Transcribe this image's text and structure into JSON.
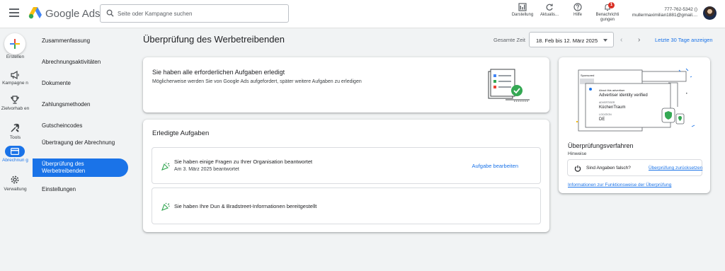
{
  "header": {
    "brand": "Google Ads",
    "search_placeholder": "Seite oder Kampagne suchen",
    "tools": {
      "appearance": "Darstellung",
      "refresh": "Aktualis...",
      "help": "Hilfe",
      "notifications": "Benachrichti gungen",
      "notification_count": "1"
    },
    "account_id": "777-762-5342 ()",
    "account_email": "mullermaximilian1881@gmail...."
  },
  "rail": {
    "create": "Erstellen",
    "campaigns": "Kampagne n",
    "goals": "Zielvorhab en",
    "tools": "Tools",
    "billing": "Abrechnun g",
    "admin": "Verwaltung"
  },
  "subnav": {
    "items": [
      "Zusammenfassung",
      "Abrechnungsaktivitäten",
      "Dokumente",
      "Zahlungsmethoden",
      "Gutscheincodes",
      "Übertragung der Abrechnung",
      "Überprüfung des Werbetreibenden",
      "Einstellungen"
    ]
  },
  "page": {
    "title": "Überprüfung des Werbetreibenden",
    "range_label": "Gesamte Zeit",
    "range_value": "18. Feb bis 12. März 2025",
    "last30": "Letzte 30 Tage anzeigen"
  },
  "summary": {
    "title": "Sie haben alle erforderlichen Aufgaben erledigt",
    "subtitle": "Möglicherweise werden Sie von Google Ads aufgefordert, später weitere Aufgaben zu erledigen"
  },
  "done": {
    "title": "Erledigte Aufgaben",
    "tasks": [
      {
        "title": "Sie haben einige Fragen zu Ihrer Organisation beantwortet",
        "sub": "Am 3. März 2025 beantwortet",
        "link": "Aufgabe bearbeiten"
      },
      {
        "title": "Sie haben Ihre Dun & Bradstreet-Informationen bereitgestellt"
      }
    ]
  },
  "side": {
    "illustration": {
      "sponsored": "Sponsored",
      "about": "About this advertiser",
      "verified": "Advertiser identity verified",
      "advertiser_label": "ADVERTISER",
      "advertiser": "KüchenTraum",
      "location_label": "LOCATION",
      "location": "DE"
    },
    "title": "Überprüfungsverfahren",
    "subtitle": "Hinweise",
    "question": "Sind Angaben falsch?",
    "reset": "Überprüfung zurücksetzen",
    "info": "Informationen zur Funktionsweise der Überprüfung"
  },
  "colors": {
    "accent": "#1a73e8",
    "success": "#34a853",
    "badge": "#d93025"
  }
}
